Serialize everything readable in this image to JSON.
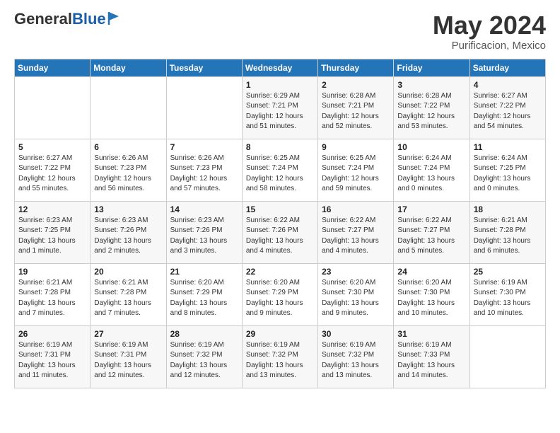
{
  "logo": {
    "general": "General",
    "blue": "Blue"
  },
  "title": "May 2024",
  "location": "Purificacion, Mexico",
  "days_of_week": [
    "Sunday",
    "Monday",
    "Tuesday",
    "Wednesday",
    "Thursday",
    "Friday",
    "Saturday"
  ],
  "weeks": [
    [
      {
        "day": "",
        "info": ""
      },
      {
        "day": "",
        "info": ""
      },
      {
        "day": "",
        "info": ""
      },
      {
        "day": "1",
        "info": "Sunrise: 6:29 AM\nSunset: 7:21 PM\nDaylight: 12 hours\nand 51 minutes."
      },
      {
        "day": "2",
        "info": "Sunrise: 6:28 AM\nSunset: 7:21 PM\nDaylight: 12 hours\nand 52 minutes."
      },
      {
        "day": "3",
        "info": "Sunrise: 6:28 AM\nSunset: 7:22 PM\nDaylight: 12 hours\nand 53 minutes."
      },
      {
        "day": "4",
        "info": "Sunrise: 6:27 AM\nSunset: 7:22 PM\nDaylight: 12 hours\nand 54 minutes."
      }
    ],
    [
      {
        "day": "5",
        "info": "Sunrise: 6:27 AM\nSunset: 7:22 PM\nDaylight: 12 hours\nand 55 minutes."
      },
      {
        "day": "6",
        "info": "Sunrise: 6:26 AM\nSunset: 7:23 PM\nDaylight: 12 hours\nand 56 minutes."
      },
      {
        "day": "7",
        "info": "Sunrise: 6:26 AM\nSunset: 7:23 PM\nDaylight: 12 hours\nand 57 minutes."
      },
      {
        "day": "8",
        "info": "Sunrise: 6:25 AM\nSunset: 7:24 PM\nDaylight: 12 hours\nand 58 minutes."
      },
      {
        "day": "9",
        "info": "Sunrise: 6:25 AM\nSunset: 7:24 PM\nDaylight: 12 hours\nand 59 minutes."
      },
      {
        "day": "10",
        "info": "Sunrise: 6:24 AM\nSunset: 7:24 PM\nDaylight: 13 hours\nand 0 minutes."
      },
      {
        "day": "11",
        "info": "Sunrise: 6:24 AM\nSunset: 7:25 PM\nDaylight: 13 hours\nand 0 minutes."
      }
    ],
    [
      {
        "day": "12",
        "info": "Sunrise: 6:23 AM\nSunset: 7:25 PM\nDaylight: 13 hours\nand 1 minute."
      },
      {
        "day": "13",
        "info": "Sunrise: 6:23 AM\nSunset: 7:26 PM\nDaylight: 13 hours\nand 2 minutes."
      },
      {
        "day": "14",
        "info": "Sunrise: 6:23 AM\nSunset: 7:26 PM\nDaylight: 13 hours\nand 3 minutes."
      },
      {
        "day": "15",
        "info": "Sunrise: 6:22 AM\nSunset: 7:26 PM\nDaylight: 13 hours\nand 4 minutes."
      },
      {
        "day": "16",
        "info": "Sunrise: 6:22 AM\nSunset: 7:27 PM\nDaylight: 13 hours\nand 4 minutes."
      },
      {
        "day": "17",
        "info": "Sunrise: 6:22 AM\nSunset: 7:27 PM\nDaylight: 13 hours\nand 5 minutes."
      },
      {
        "day": "18",
        "info": "Sunrise: 6:21 AM\nSunset: 7:28 PM\nDaylight: 13 hours\nand 6 minutes."
      }
    ],
    [
      {
        "day": "19",
        "info": "Sunrise: 6:21 AM\nSunset: 7:28 PM\nDaylight: 13 hours\nand 7 minutes."
      },
      {
        "day": "20",
        "info": "Sunrise: 6:21 AM\nSunset: 7:28 PM\nDaylight: 13 hours\nand 7 minutes."
      },
      {
        "day": "21",
        "info": "Sunrise: 6:20 AM\nSunset: 7:29 PM\nDaylight: 13 hours\nand 8 minutes."
      },
      {
        "day": "22",
        "info": "Sunrise: 6:20 AM\nSunset: 7:29 PM\nDaylight: 13 hours\nand 9 minutes."
      },
      {
        "day": "23",
        "info": "Sunrise: 6:20 AM\nSunset: 7:30 PM\nDaylight: 13 hours\nand 9 minutes."
      },
      {
        "day": "24",
        "info": "Sunrise: 6:20 AM\nSunset: 7:30 PM\nDaylight: 13 hours\nand 10 minutes."
      },
      {
        "day": "25",
        "info": "Sunrise: 6:19 AM\nSunset: 7:30 PM\nDaylight: 13 hours\nand 10 minutes."
      }
    ],
    [
      {
        "day": "26",
        "info": "Sunrise: 6:19 AM\nSunset: 7:31 PM\nDaylight: 13 hours\nand 11 minutes."
      },
      {
        "day": "27",
        "info": "Sunrise: 6:19 AM\nSunset: 7:31 PM\nDaylight: 13 hours\nand 12 minutes."
      },
      {
        "day": "28",
        "info": "Sunrise: 6:19 AM\nSunset: 7:32 PM\nDaylight: 13 hours\nand 12 minutes."
      },
      {
        "day": "29",
        "info": "Sunrise: 6:19 AM\nSunset: 7:32 PM\nDaylight: 13 hours\nand 13 minutes."
      },
      {
        "day": "30",
        "info": "Sunrise: 6:19 AM\nSunset: 7:32 PM\nDaylight: 13 hours\nand 13 minutes."
      },
      {
        "day": "31",
        "info": "Sunrise: 6:19 AM\nSunset: 7:33 PM\nDaylight: 13 hours\nand 14 minutes."
      },
      {
        "day": "",
        "info": ""
      }
    ]
  ]
}
